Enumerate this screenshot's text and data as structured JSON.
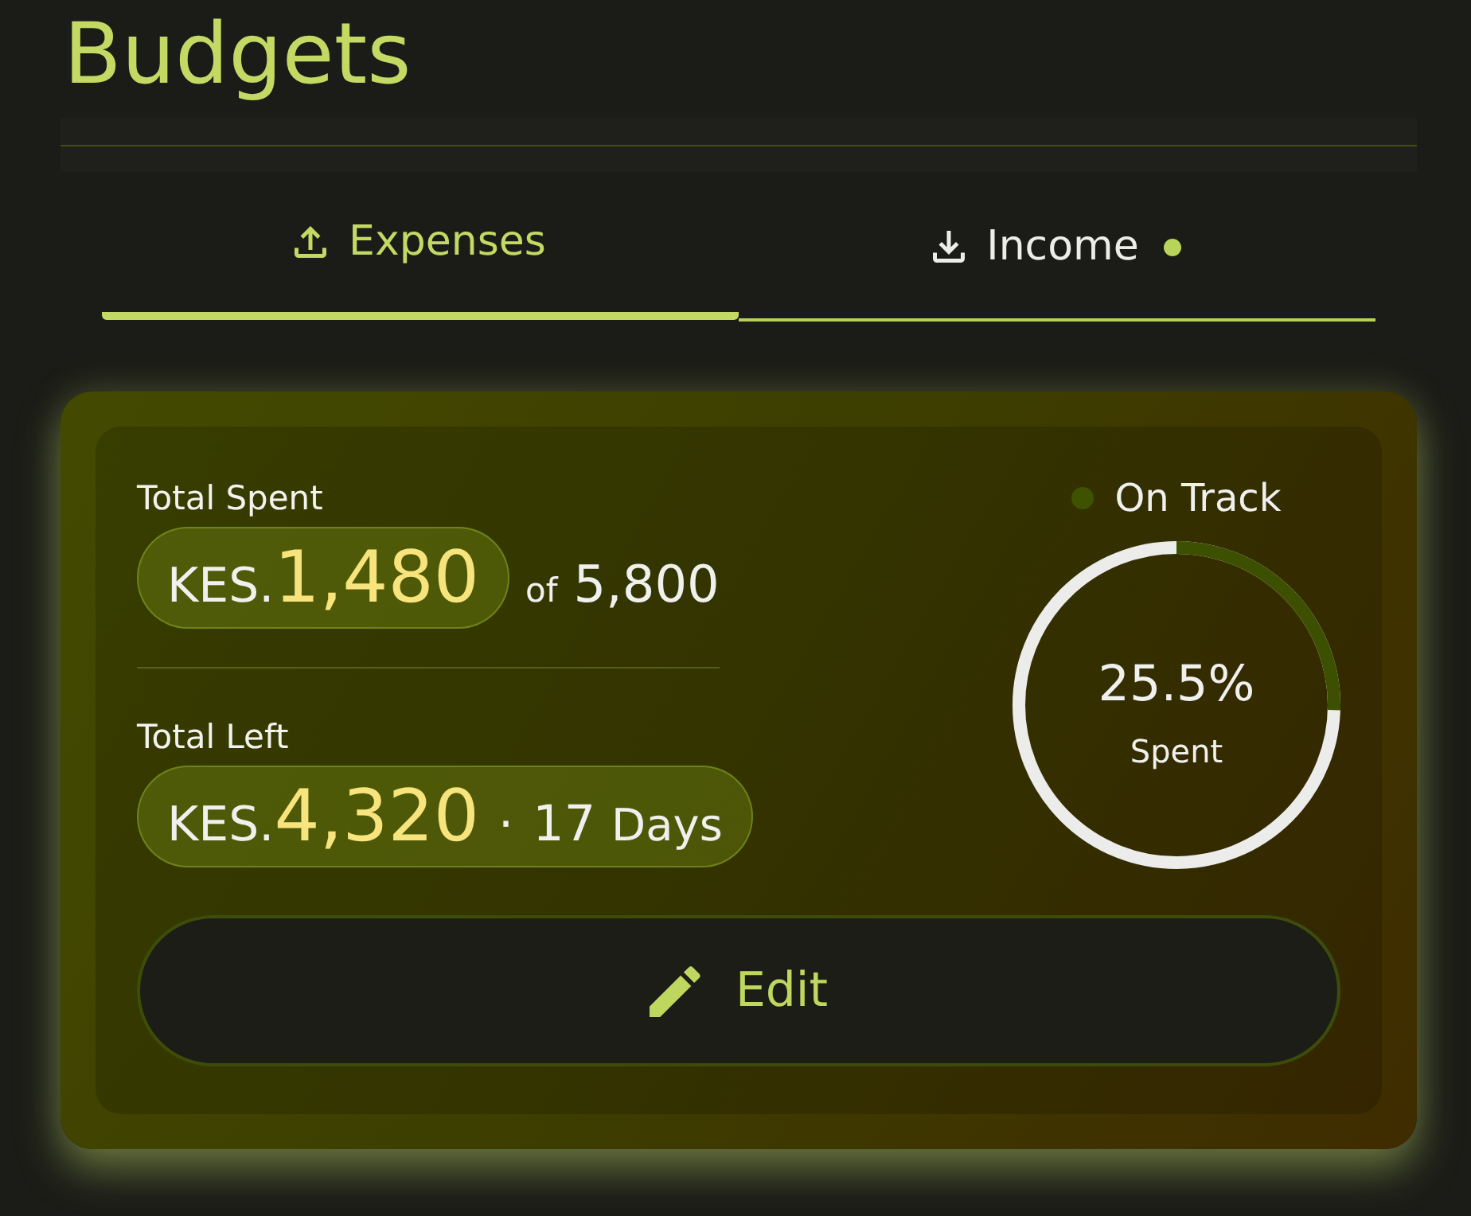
{
  "page": {
    "title": "Budgets"
  },
  "tabs": [
    {
      "kind": "expense",
      "label": "Expenses",
      "selected": true,
      "notification_dot": false
    },
    {
      "kind": "income",
      "label": "Income",
      "selected": false,
      "notification_dot": true
    }
  ],
  "summary": {
    "spent": {
      "label": "Total Spent",
      "currency": "KES.",
      "amount": "1,480",
      "of_word": "of",
      "total": "5,800"
    },
    "left": {
      "label": "Total Left",
      "currency": "KES.",
      "amount": "4,320",
      "separator": "·",
      "days": "17",
      "days_word": "Days"
    },
    "status": {
      "label": "On Track",
      "color": "#3f5200"
    },
    "progress": {
      "level": 0.255,
      "percent": "25.5%",
      "caption": "Spent"
    },
    "edit_button": {
      "label": "Edit"
    }
  }
}
